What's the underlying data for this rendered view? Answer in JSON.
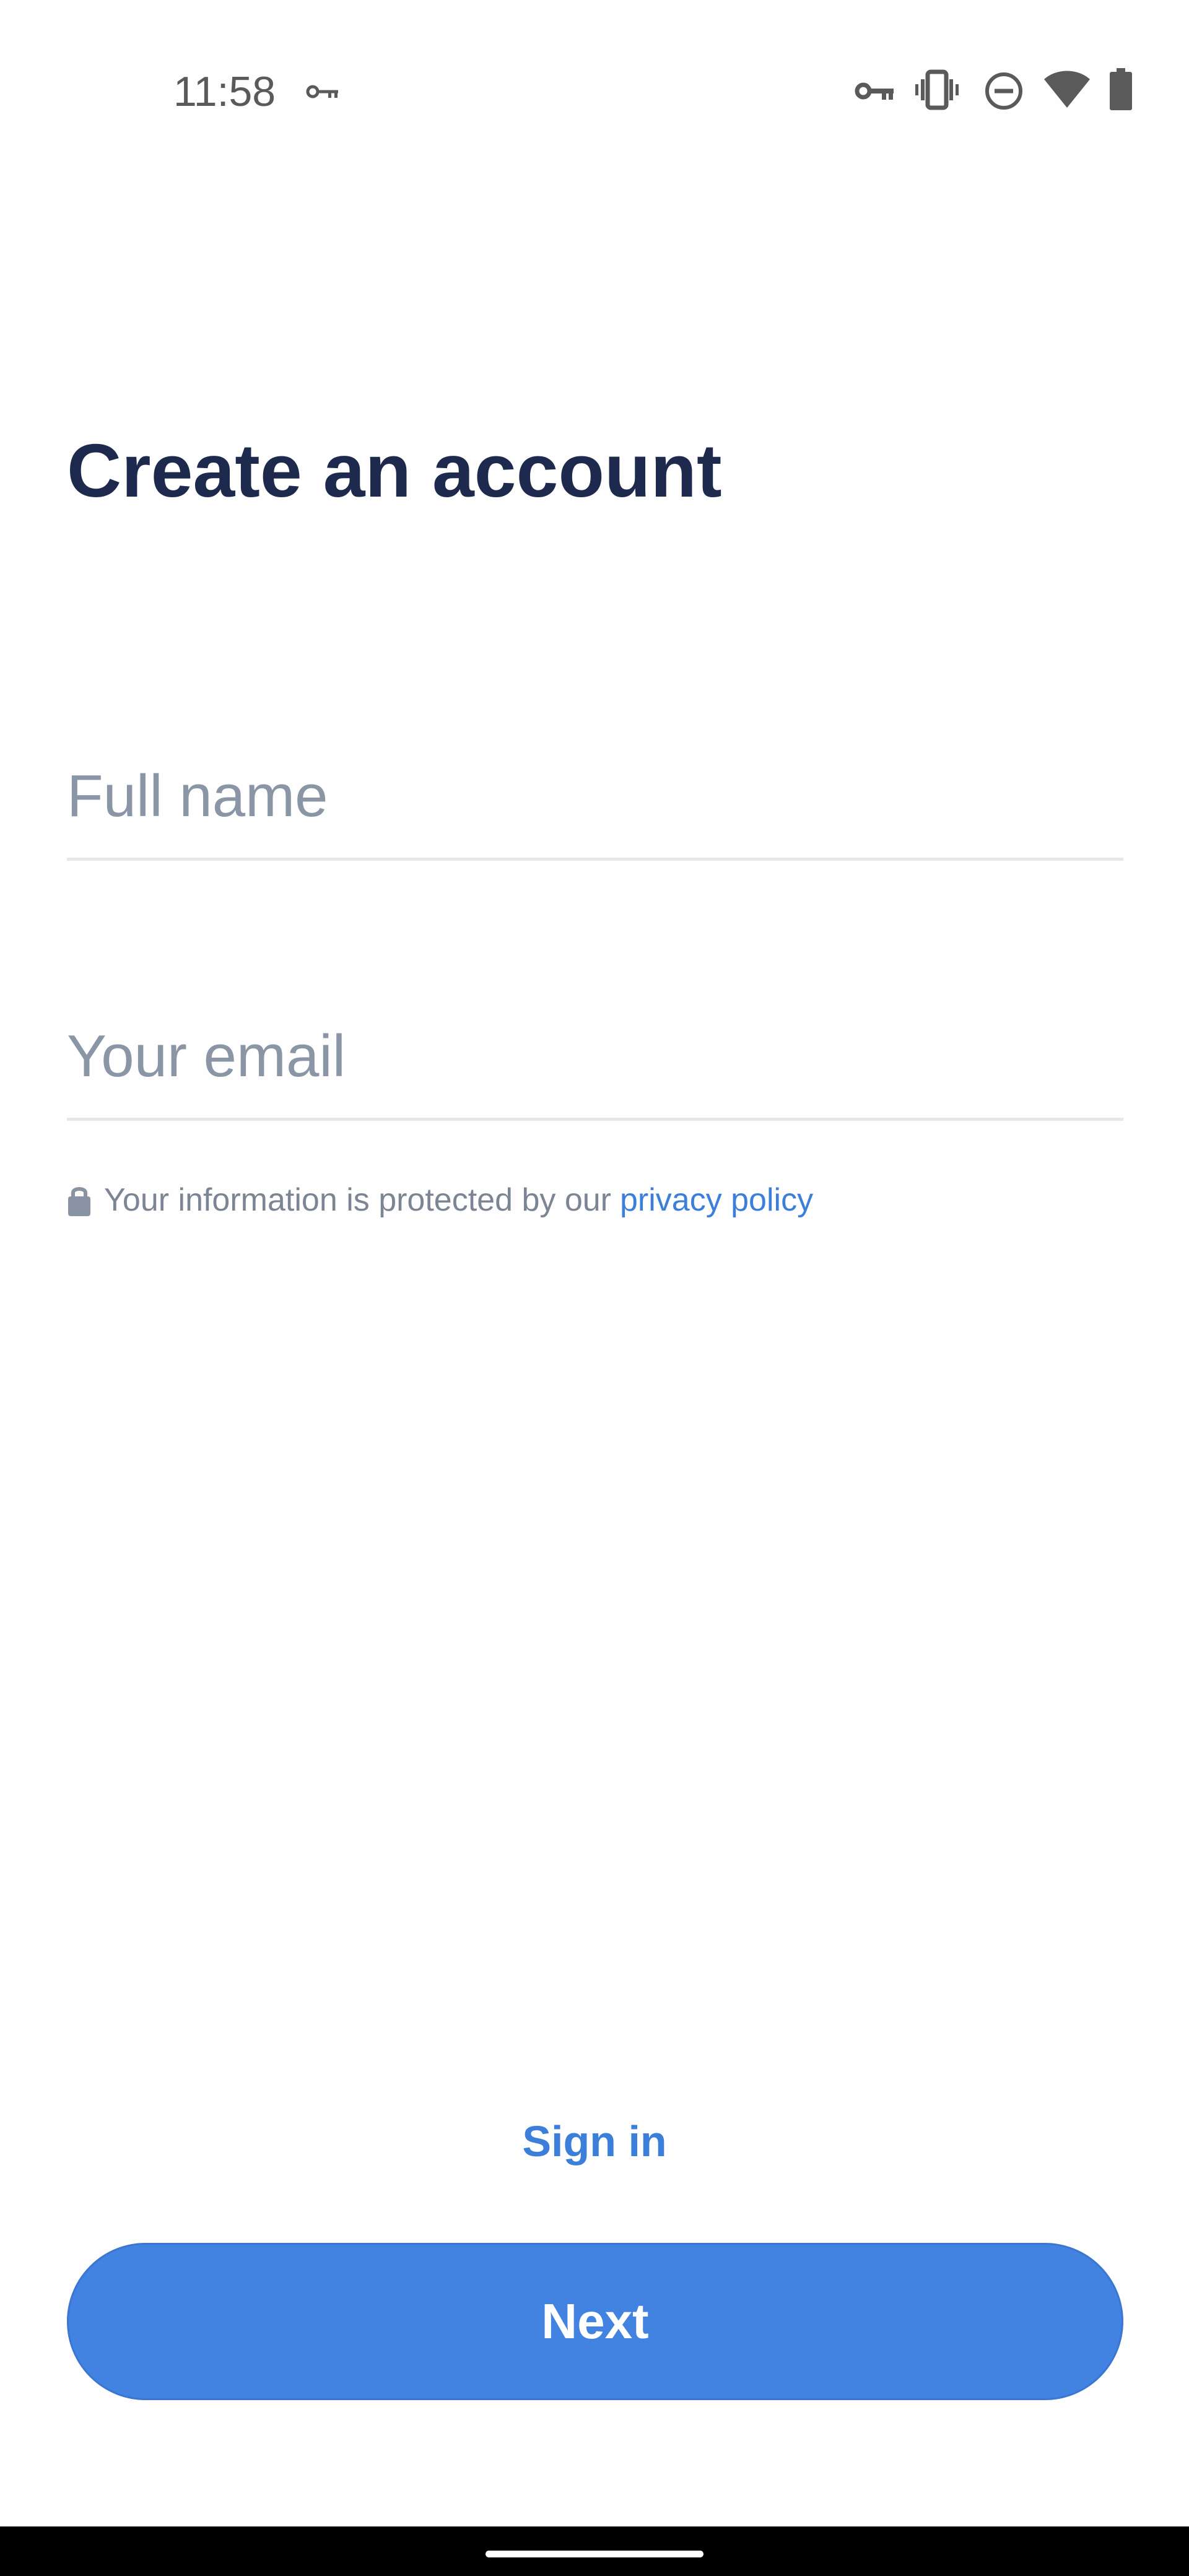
{
  "status_bar": {
    "time": "11:58",
    "icons": [
      "vpn-key-icon",
      "vpn-key-icon",
      "vibrate-icon",
      "do-not-disturb-icon",
      "wifi-icon",
      "battery-icon"
    ]
  },
  "page": {
    "title": "Create an account"
  },
  "form": {
    "full_name": {
      "value": "",
      "placeholder": "Full name"
    },
    "email": {
      "value": "",
      "placeholder": "Your email"
    }
  },
  "privacy": {
    "text": "Your information is protected by our",
    "link_label": "privacy policy"
  },
  "actions": {
    "sign_in_label": "Sign in",
    "next_label": "Next"
  },
  "colors": {
    "title": "#1d2a4e",
    "accent": "#4282e0",
    "link": "#3b7fdb",
    "placeholder": "#8a95a6",
    "divider": "#e6e7ea"
  }
}
